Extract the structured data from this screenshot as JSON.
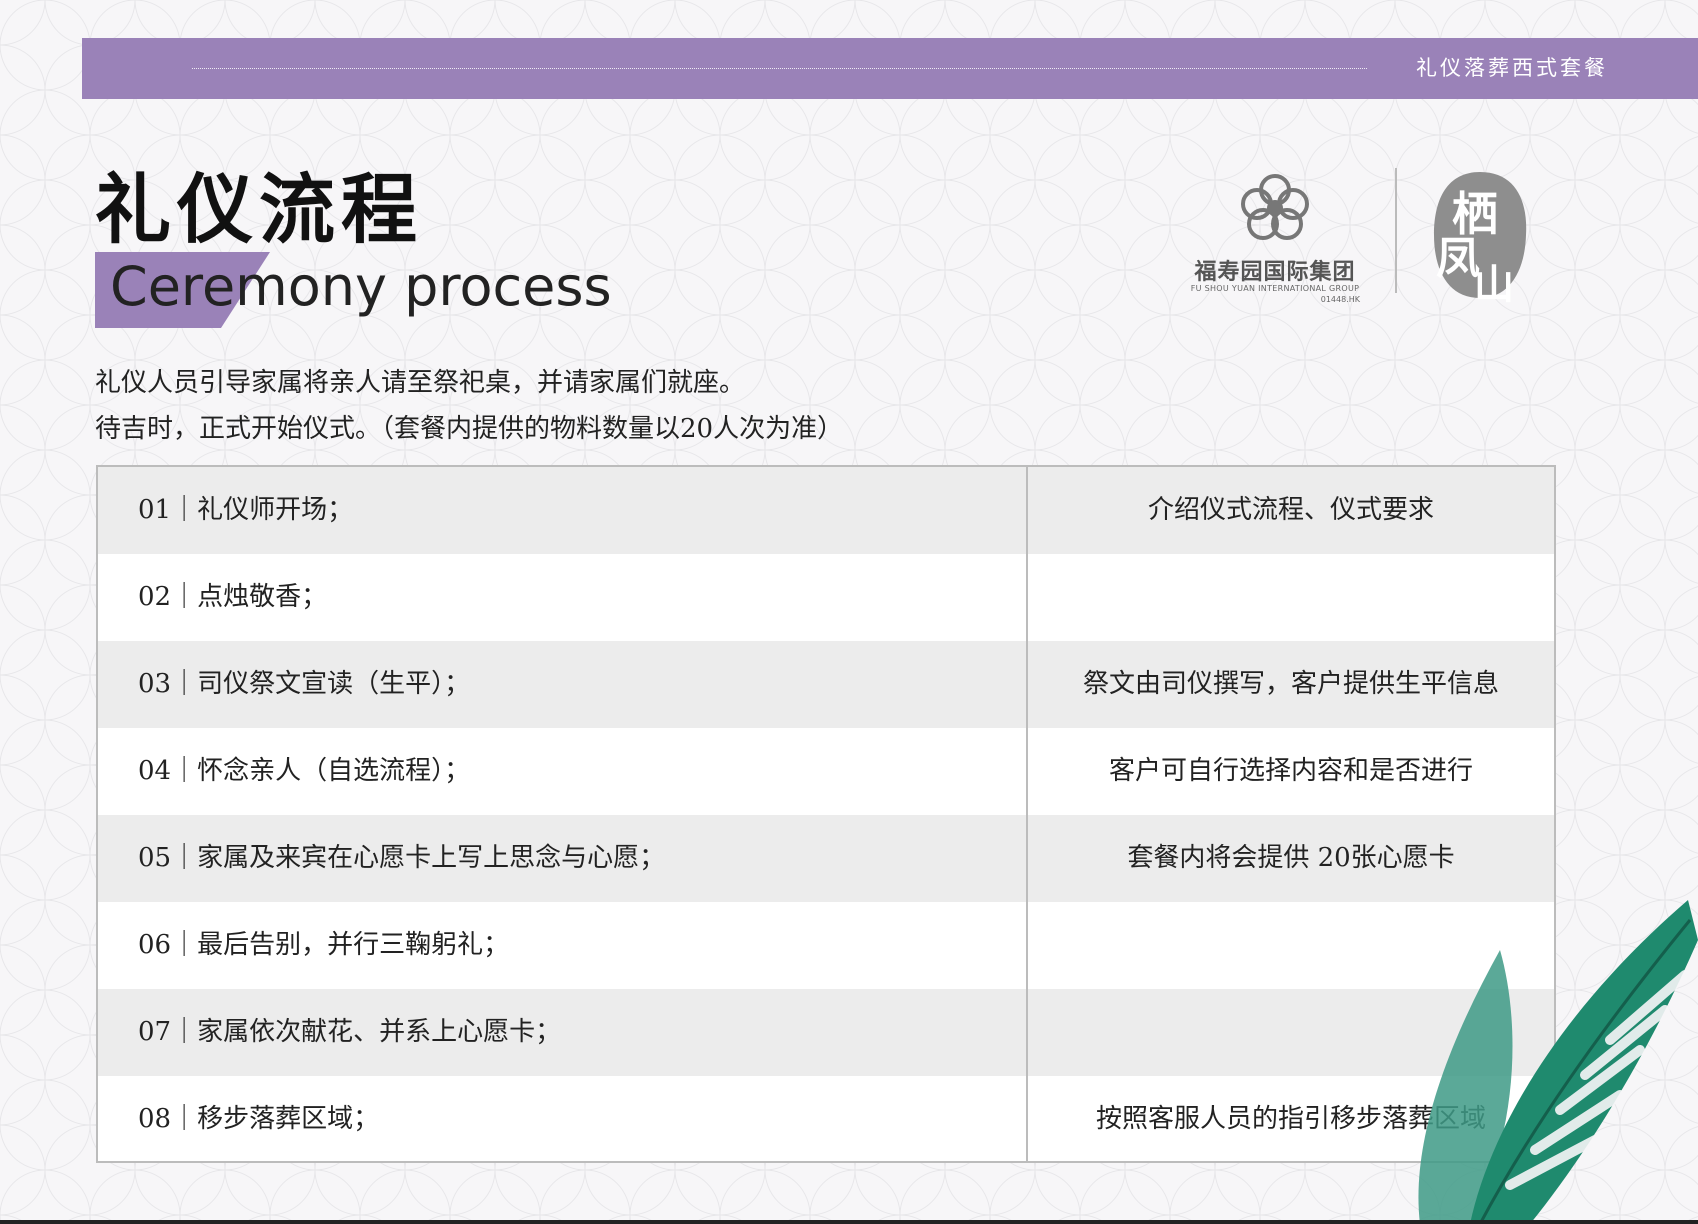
{
  "header": {
    "label": "礼仪落葬西式套餐"
  },
  "title": {
    "cn": "礼仪流程",
    "en": "Ceremony process"
  },
  "intro": [
    "礼仪人员引导家属将亲人请至祭祀桌，并请家属们就座。",
    "待吉时，正式开始仪式。（套餐内提供的物料数量以20人次为准）"
  ],
  "logo": {
    "name": "福寿园国际集团",
    "name_en": "FU SHOU YUAN INTERNATIONAL GROUP",
    "code": "01448.HK",
    "seal_chars": [
      "栖",
      "凤",
      "山"
    ]
  },
  "steps": [
    {
      "label": "01｜礼仪师开场；",
      "note": "介绍仪式流程、仪式要求"
    },
    {
      "label": "02｜点烛敬香；",
      "note": ""
    },
    {
      "label": "03｜司仪祭文宣读（生平）；",
      "note": "祭文由司仪撰写，客户提供生平信息"
    },
    {
      "label": "04｜怀念亲人（自选流程）；",
      "note": "客户可自行选择内容和是否进行"
    },
    {
      "label": "05｜家属及来宾在心愿卡上写上思念与心愿；",
      "note": "套餐内将会提供 20张心愿卡"
    },
    {
      "label": "06｜最后告别，并行三鞠躬礼；",
      "note": ""
    },
    {
      "label": "07｜家属依次献花、并系上心愿卡；",
      "note": ""
    },
    {
      "label": "08｜移步落葬区域；",
      "note": "按照客服人员的指引移步落葬区域"
    }
  ],
  "colors": {
    "accent": "#9a82b8",
    "row_shade": "#ececec",
    "leaf": "#1f8a6e"
  }
}
